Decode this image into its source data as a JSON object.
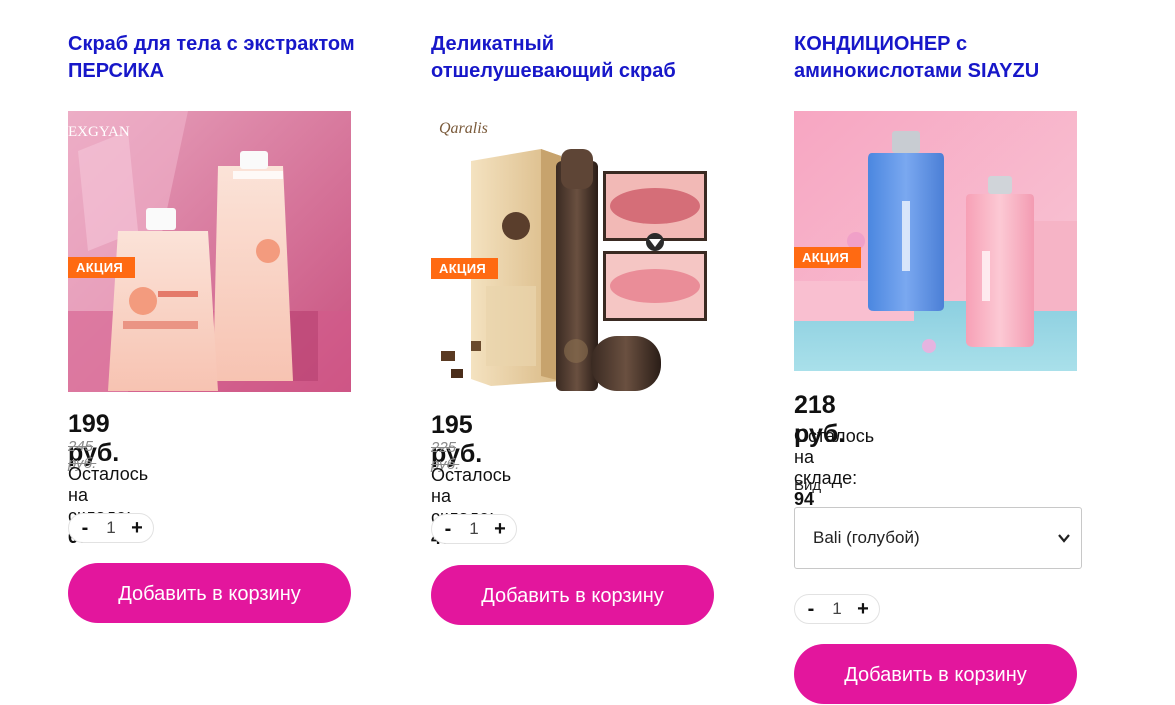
{
  "products": [
    {
      "title": "Скраб для тела с экстрактом ПЕРСИКА",
      "badge": "АКЦИЯ",
      "image_brand": "EXGYAN",
      "price": "199 руб.",
      "old_price": "245 руб.",
      "stock_label": "Осталось на складе:",
      "stock_value": "60",
      "quantity": "1",
      "minus": "-",
      "plus": "+",
      "add_label": "Добавить в корзину"
    },
    {
      "title": "Деликатный отшелушевающий скраб",
      "badge": "АКЦИЯ",
      "image_brand": "Qaralis",
      "price": "195 руб.",
      "old_price": "225 руб.",
      "stock_label": "Осталось на складе:",
      "stock_value": "40",
      "quantity": "1",
      "minus": "-",
      "plus": "+",
      "add_label": "Добавить в корзину"
    },
    {
      "title": "КОНДИЦИОНЕР с аминокислотами SIAYZU",
      "badge": "АКЦИЯ",
      "price": "218 руб.",
      "stock_label": "Осталось на складе:",
      "stock_value": "94",
      "variant_label": "Вид",
      "variant_selected": "Bali (голубой)",
      "quantity": "1",
      "minus": "-",
      "plus": "+",
      "add_label": "Добавить в корзину"
    }
  ],
  "colors": {
    "title": "#1717c9",
    "badge": "#ff6a12",
    "button": "#e3169d"
  }
}
